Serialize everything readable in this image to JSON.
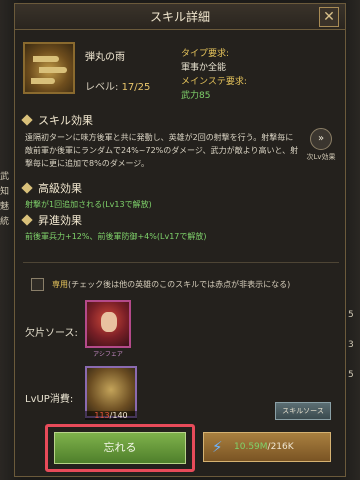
{
  "title": "スキル詳細",
  "skill": {
    "name": "弾丸の雨",
    "level_label": "レベル: ",
    "level_value": "17/25",
    "type_req_label": "タイプ要求:",
    "type_req_value": "軍事か全能",
    "main_stat_label": "メインステ要求:",
    "main_stat_value": "武力85"
  },
  "effect": {
    "heading": "スキル効果",
    "text": "遠隔初ターンに味方後軍と共に発動し、英雄が2回の射撃を行う。射撃毎に敵前軍か後軍にランダムで24%~72%のダメージ、武力が敵より高いと、射撃毎に更に追加で8%のダメージ。"
  },
  "next_effect_label": "次Lv効果",
  "advanced": {
    "heading": "高級効果",
    "text": "射撃が1回追加される(Lv13で解放)"
  },
  "promotion": {
    "heading": "昇進効果",
    "text": "前後軍兵力+12%、前後軍防御+4%(Lv17で解放)"
  },
  "exclusive": {
    "word": "専用",
    "note": "(チェック後は他の英雄のこのスキルでは赤点が非表示になる)"
  },
  "fragment_source_label": "欠片ソース:",
  "hero_name": "アシフェア",
  "lvup_label": "LvUP消費:",
  "item_count": {
    "have": "113",
    "need": "/140"
  },
  "skill_source_button": "スキルソース",
  "forget_button": "忘れる",
  "cost": {
    "have": "10.59M",
    "need": "/216K"
  },
  "side_left": [
    "武",
    "知",
    "魅",
    "統"
  ],
  "side_right": [
    "5",
    "3",
    "5"
  ],
  "colors": {
    "accent_gold": "#e5c35b",
    "green": "#7fd36b",
    "red_highlight": "#e84b5a"
  }
}
